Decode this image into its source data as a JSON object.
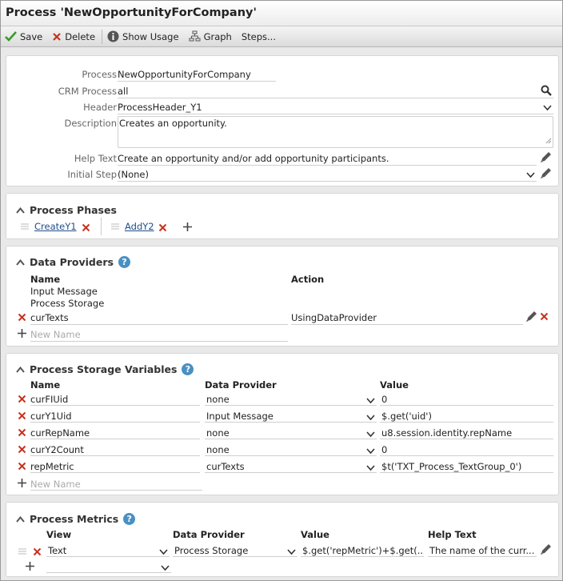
{
  "window": {
    "title": "Process 'NewOpportunityForCompany'"
  },
  "toolbar": {
    "save_label": "Save",
    "delete_label": "Delete",
    "show_usage_label": "Show Usage",
    "graph_label": "Graph",
    "steps_label": "Steps..."
  },
  "properties": {
    "process_label": "Process",
    "process_value": "NewOpportunityForCompany",
    "crm_process_label": "CRM Process",
    "crm_process_value": "all",
    "header_label": "Header",
    "header_value": "ProcessHeader_Y1",
    "description_label": "Description",
    "description_value": "Creates an opportunity.",
    "help_text_label": "Help Text",
    "help_text_value": "Create an opportunity and/or add opportunity participants.",
    "initial_step_label": "Initial Step",
    "initial_step_value": "(None)"
  },
  "phases": {
    "title": "Process Phases",
    "items": [
      {
        "label": "CreateY1"
      },
      {
        "label": "AddY2"
      }
    ]
  },
  "data_providers": {
    "title": "Data Providers",
    "col_name": "Name",
    "col_action": "Action",
    "static_rows": [
      "Input Message",
      "Process Storage"
    ],
    "rows": [
      {
        "name": "curTexts",
        "action": "UsingDataProvider"
      }
    ],
    "new_placeholder": "New Name"
  },
  "storage_vars": {
    "title": "Process Storage Variables",
    "col_name": "Name",
    "col_provider": "Data Provider",
    "col_value": "Value",
    "rows": [
      {
        "name": "curFIUid",
        "provider": "none",
        "value": "0"
      },
      {
        "name": "curY1Uid",
        "provider": "Input Message",
        "value": "$.get('uid')"
      },
      {
        "name": "curRepName",
        "provider": "none",
        "value": "u8.session.identity.repName"
      },
      {
        "name": "curY2Count",
        "provider": "none",
        "value": "0"
      },
      {
        "name": "repMetric",
        "provider": "curTexts",
        "value": "$t('TXT_Process_TextGroup_0')"
      }
    ],
    "new_placeholder": "New Name"
  },
  "metrics": {
    "title": "Process Metrics",
    "col_view": "View",
    "col_provider": "Data Provider",
    "col_value": "Value",
    "col_help": "Help Text",
    "rows": [
      {
        "view": "Text",
        "provider": "Process Storage",
        "value": "$.get('repMetric')+$.get(...",
        "help": "The name of the curr..."
      }
    ]
  },
  "colors": {
    "delete_red": "#c8321e",
    "save_green": "#3a9a2a",
    "help_blue": "#4a90c2",
    "link_blue": "#1f4e8c"
  }
}
